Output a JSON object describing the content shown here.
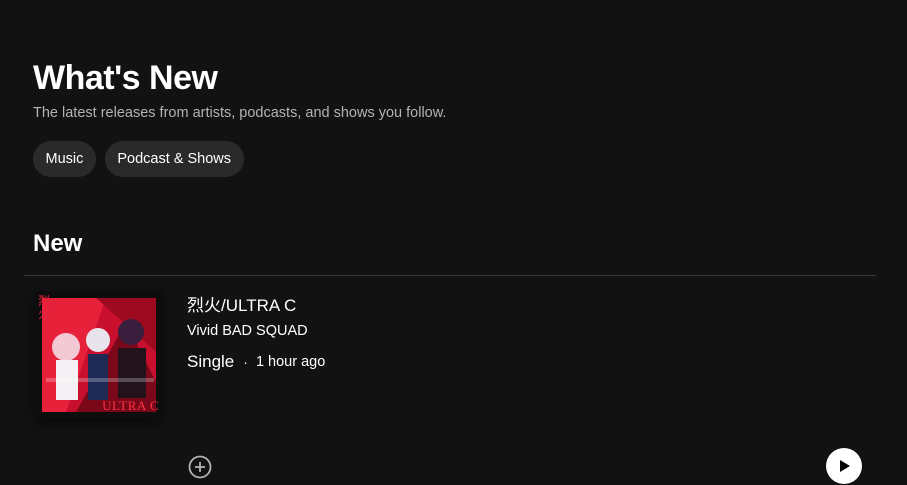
{
  "header": {
    "title": "What's New",
    "subtitle": "The latest releases from artists, podcasts, and shows you follow."
  },
  "filters": [
    {
      "label": "Music"
    },
    {
      "label": "Podcast & Shows"
    }
  ],
  "section": {
    "title": "New"
  },
  "releases": [
    {
      "title": "烈火/ULTRA C",
      "artist": "Vivid BAD SQUAD",
      "type": "Single",
      "separator": "·",
      "time": "1 hour ago",
      "cover_text": "ULTRA C",
      "cover_vertical_text": "烈火",
      "cover_colors": {
        "primary": "#c8102e",
        "dark": "#1a0608",
        "accent": "#ff3344"
      }
    }
  ],
  "icons": {
    "add": "plus-circle-icon",
    "play": "play-icon"
  },
  "colors": {
    "background": "#121212",
    "chip": "#2a2a2a",
    "secondary_text": "#b3b3b3"
  }
}
